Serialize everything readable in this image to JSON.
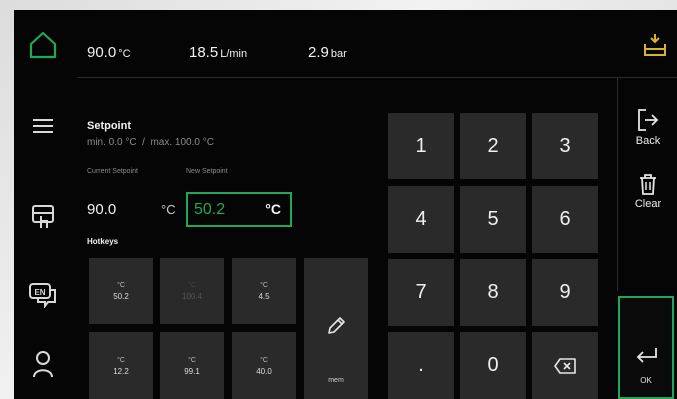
{
  "status_bar": {
    "temperature": {
      "value": "90.0",
      "unit": "°C"
    },
    "flow": {
      "value": "18.5",
      "unit": "L/min"
    },
    "pressure": {
      "value": "2.9",
      "unit": "bar"
    }
  },
  "setpoint": {
    "title": "Setpoint",
    "range": "min. 0.0 °C  /  max. 100.0 °C",
    "current_label": "Current Setpoint",
    "new_label": "New Setpoint",
    "current_value": "90.0",
    "current_unit": "°C",
    "new_value": "50.2",
    "new_unit": "°C"
  },
  "hotkeys": {
    "title": "Hotkeys",
    "unit": "°C",
    "items": [
      "50.2",
      "100.4",
      "4.5",
      "12.2",
      "99.1",
      "40.0"
    ],
    "mem_label": "mem"
  },
  "keypad": {
    "keys": [
      "1",
      "2",
      "3",
      "4",
      "5",
      "6",
      "7",
      "8",
      "9",
      ".",
      "0"
    ]
  },
  "actions": {
    "back_label": "Back",
    "clear_label": "Clear",
    "ok_label": "OK"
  },
  "colors": {
    "accent": "#1fa85a",
    "background": "#050505",
    "key": "#2a2a2a"
  },
  "icons": [
    "home-icon",
    "bath-icon",
    "menu-icon",
    "touch-device-icon",
    "language-icon",
    "user-icon",
    "pencil-icon",
    "backspace-icon",
    "back-icon",
    "trash-icon",
    "enter-icon"
  ]
}
